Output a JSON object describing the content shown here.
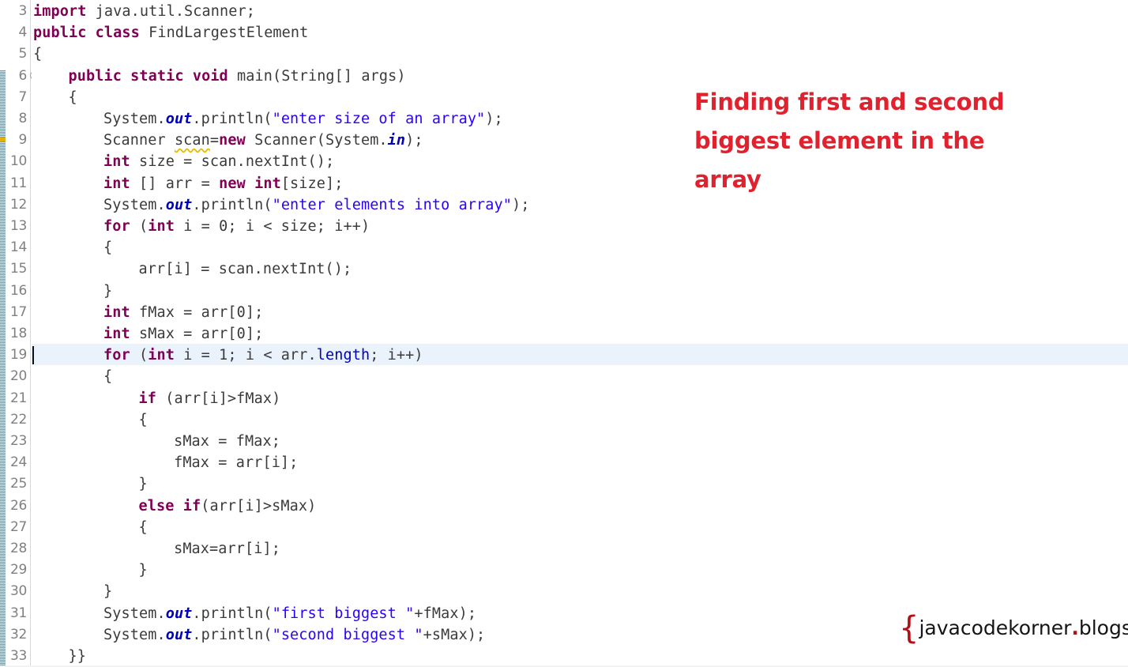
{
  "editor": {
    "name": "java-code-editor",
    "language": "Java",
    "first_line_number": 3,
    "last_line_number": 33,
    "current_line": 19,
    "colors": {
      "background": "#ffffff",
      "keyword": "#7f0055",
      "string": "#2a00ff",
      "field": "#0000c0",
      "plain": "#3b3b3b",
      "line_number": "#808080",
      "current_line_highlight": "#eaf2fb",
      "warning_marker": "#e7b000",
      "annotation_band": "#2e9bb5"
    },
    "lines": [
      {
        "n": 3,
        "indent": 0,
        "tokens": [
          {
            "t": "kw",
            "v": "import"
          },
          {
            "t": "pln",
            "v": " java.util.Scanner;"
          }
        ]
      },
      {
        "n": 4,
        "indent": 0,
        "tokens": [
          {
            "t": "kw",
            "v": "public class"
          },
          {
            "t": "pln",
            "v": " FindLargestElement"
          }
        ]
      },
      {
        "n": 5,
        "indent": 0,
        "tokens": [
          {
            "t": "pln",
            "v": "{"
          }
        ]
      },
      {
        "n": 6,
        "indent": 1,
        "fold": true,
        "tokens": [
          {
            "t": "kw",
            "v": "public static void"
          },
          {
            "t": "pln",
            "v": " main(String[] args)"
          }
        ]
      },
      {
        "n": 7,
        "indent": 1,
        "tokens": [
          {
            "t": "pln",
            "v": "{"
          }
        ]
      },
      {
        "n": 8,
        "indent": 2,
        "tokens": [
          {
            "t": "pln",
            "v": "System."
          },
          {
            "t": "fld",
            "v": "out"
          },
          {
            "t": "pln",
            "v": ".println("
          },
          {
            "t": "str",
            "v": "\"enter size of an array\""
          },
          {
            "t": "pln",
            "v": ");"
          }
        ]
      },
      {
        "n": 9,
        "indent": 2,
        "warning": true,
        "tokens": [
          {
            "t": "pln",
            "v": "Scanner "
          },
          {
            "t": "warn",
            "v": "scan"
          },
          {
            "t": "pln",
            "v": "="
          },
          {
            "t": "kw",
            "v": "new"
          },
          {
            "t": "pln",
            "v": " Scanner(System."
          },
          {
            "t": "fld",
            "v": "in"
          },
          {
            "t": "pln",
            "v": ");"
          }
        ]
      },
      {
        "n": 10,
        "indent": 2,
        "tokens": [
          {
            "t": "kw",
            "v": "int"
          },
          {
            "t": "pln",
            "v": " size = scan.nextInt();"
          }
        ]
      },
      {
        "n": 11,
        "indent": 2,
        "tokens": [
          {
            "t": "kw",
            "v": "int"
          },
          {
            "t": "pln",
            "v": " [] arr = "
          },
          {
            "t": "kw",
            "v": "new int"
          },
          {
            "t": "pln",
            "v": "[size];"
          }
        ]
      },
      {
        "n": 12,
        "indent": 2,
        "tokens": [
          {
            "t": "pln",
            "v": "System."
          },
          {
            "t": "fld",
            "v": "out"
          },
          {
            "t": "pln",
            "v": ".println("
          },
          {
            "t": "str",
            "v": "\"enter elements into array\""
          },
          {
            "t": "pln",
            "v": ");"
          }
        ]
      },
      {
        "n": 13,
        "indent": 2,
        "tokens": [
          {
            "t": "kw",
            "v": "for"
          },
          {
            "t": "pln",
            "v": " ("
          },
          {
            "t": "kw",
            "v": "int"
          },
          {
            "t": "pln",
            "v": " i = 0; i < size; i++)"
          }
        ]
      },
      {
        "n": 14,
        "indent": 2,
        "tokens": [
          {
            "t": "pln",
            "v": "{"
          }
        ]
      },
      {
        "n": 15,
        "indent": 3,
        "tokens": [
          {
            "t": "pln",
            "v": "arr[i] = scan.nextInt();"
          }
        ]
      },
      {
        "n": 16,
        "indent": 2,
        "tokens": [
          {
            "t": "pln",
            "v": "}"
          }
        ]
      },
      {
        "n": 17,
        "indent": 2,
        "tokens": [
          {
            "t": "kw",
            "v": "int"
          },
          {
            "t": "pln",
            "v": " fMax = arr[0];"
          }
        ]
      },
      {
        "n": 18,
        "indent": 2,
        "tokens": [
          {
            "t": "kw",
            "v": "int"
          },
          {
            "t": "pln",
            "v": " sMax = arr[0];"
          }
        ]
      },
      {
        "n": 19,
        "indent": 2,
        "current": true,
        "tokens": [
          {
            "t": "kw",
            "v": "for"
          },
          {
            "t": "pln",
            "v": " ("
          },
          {
            "t": "kw",
            "v": "int"
          },
          {
            "t": "pln",
            "v": " i = 1; i < arr."
          },
          {
            "t": "fldn",
            "v": "length"
          },
          {
            "t": "pln",
            "v": "; i++)"
          }
        ]
      },
      {
        "n": 20,
        "indent": 2,
        "tokens": [
          {
            "t": "pln",
            "v": "{"
          }
        ]
      },
      {
        "n": 21,
        "indent": 3,
        "tokens": [
          {
            "t": "kw",
            "v": "if"
          },
          {
            "t": "pln",
            "v": " (arr[i]>fMax)"
          }
        ]
      },
      {
        "n": 22,
        "indent": 3,
        "tokens": [
          {
            "t": "pln",
            "v": "{"
          }
        ]
      },
      {
        "n": 23,
        "indent": 4,
        "tokens": [
          {
            "t": "pln",
            "v": "sMax = fMax;"
          }
        ]
      },
      {
        "n": 24,
        "indent": 4,
        "tokens": [
          {
            "t": "pln",
            "v": "fMax = arr[i];"
          }
        ]
      },
      {
        "n": 25,
        "indent": 3,
        "tokens": [
          {
            "t": "pln",
            "v": "}"
          }
        ]
      },
      {
        "n": 26,
        "indent": 3,
        "tokens": [
          {
            "t": "kw",
            "v": "else if"
          },
          {
            "t": "pln",
            "v": "(arr[i]>sMax)"
          }
        ]
      },
      {
        "n": 27,
        "indent": 3,
        "tokens": [
          {
            "t": "pln",
            "v": "{"
          }
        ]
      },
      {
        "n": 28,
        "indent": 4,
        "tokens": [
          {
            "t": "pln",
            "v": "sMax=arr[i];"
          }
        ]
      },
      {
        "n": 29,
        "indent": 3,
        "tokens": [
          {
            "t": "pln",
            "v": "}"
          }
        ]
      },
      {
        "n": 30,
        "indent": 2,
        "tokens": [
          {
            "t": "pln",
            "v": "}"
          }
        ]
      },
      {
        "n": 31,
        "indent": 2,
        "tokens": [
          {
            "t": "pln",
            "v": "System."
          },
          {
            "t": "fld",
            "v": "out"
          },
          {
            "t": "pln",
            "v": ".println("
          },
          {
            "t": "str",
            "v": "\"first biggest \""
          },
          {
            "t": "pln",
            "v": "+fMax);"
          }
        ]
      },
      {
        "n": 32,
        "indent": 2,
        "tokens": [
          {
            "t": "pln",
            "v": "System."
          },
          {
            "t": "fld",
            "v": "out"
          },
          {
            "t": "pln",
            "v": ".println("
          },
          {
            "t": "str",
            "v": "\"second biggest \""
          },
          {
            "t": "pln",
            "v": "+sMax);"
          }
        ]
      },
      {
        "n": 33,
        "indent": 1,
        "tokens": [
          {
            "t": "pln",
            "v": "}}"
          }
        ]
      }
    ]
  },
  "title_note": {
    "text": "Finding first and second biggest element in the array",
    "color": "#e0222f"
  },
  "watermark": {
    "open_brace": "{",
    "part1": "javacodekorner",
    "dot": ".",
    "part2": "blogspot.com",
    "close_brace": "}",
    "full_text": "{javacodekorner.blogspot.com}",
    "brace_color": "#b31015"
  }
}
